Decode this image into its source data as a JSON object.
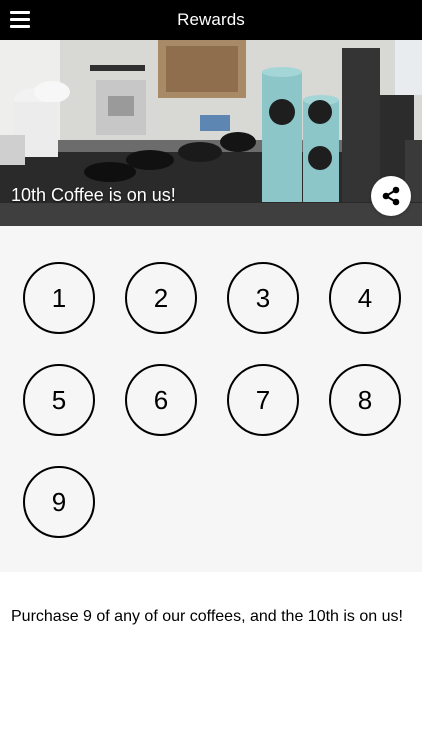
{
  "header": {
    "title": "Rewards",
    "menu_icon": "hamburger-menu-icon"
  },
  "hero": {
    "caption": "10th Coffee is on us!",
    "share_icon": "share-icon"
  },
  "stamps": {
    "labels": [
      "1",
      "2",
      "3",
      "4",
      "5",
      "6",
      "7",
      "8",
      "9"
    ]
  },
  "description": "Purchase 9 of any of our coffees, and the 10th is on us!",
  "colors": {
    "header_bg": "#000000",
    "stamp_area_bg": "#f6f6f6",
    "caption_band": "#505050"
  }
}
